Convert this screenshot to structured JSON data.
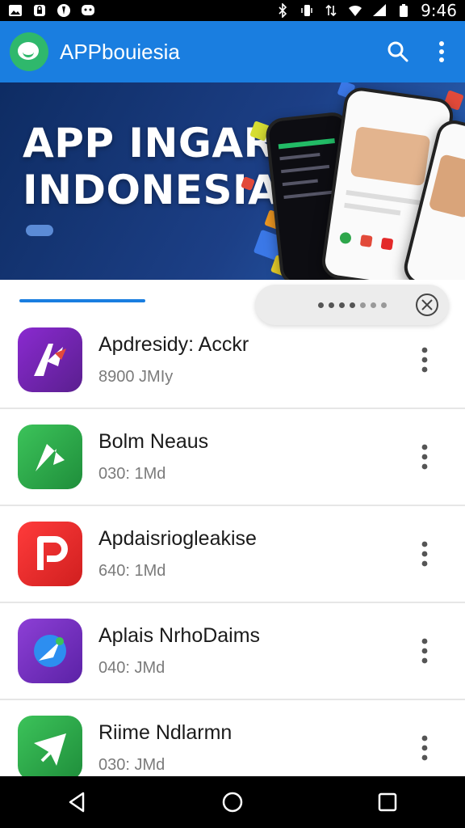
{
  "status_bar": {
    "time": "9:46",
    "left_icons": [
      "image-icon",
      "lock-icon",
      "shield-icon",
      "chat-icon"
    ],
    "right_icons": [
      "bluetooth-icon",
      "vibrate-icon",
      "data-icon",
      "wifi-icon",
      "signal-icon",
      "battery-icon"
    ]
  },
  "app_bar": {
    "title": "APPbouiesia",
    "actions": [
      "search-icon",
      "more-vert-icon"
    ],
    "brand_color": "#1a7ee0"
  },
  "banner": {
    "title_line1": "APP INGAR",
    "title_line2": "INDONESIA"
  },
  "apps": [
    {
      "name": "Apdresidy: Acckr",
      "meta": "8900 JMIy",
      "tile_color": "#6a2aa8"
    },
    {
      "name": "Bolm Neaus",
      "meta": "030: 1Md",
      "tile_color": "#2ea64b"
    },
    {
      "name": "Apdaisriogleakise",
      "meta": "640: 1Md",
      "tile_color": "#e32a2a"
    },
    {
      "name": "Aplais NrhoDaims",
      "meta": "040: JMd",
      "tile_color": "#7a3ab8"
    },
    {
      "name": "Riime Ndlarmn",
      "meta": "030: JMd",
      "tile_color": "#2ea64b"
    }
  ],
  "nav": [
    "back-icon",
    "home-icon",
    "recents-icon"
  ]
}
